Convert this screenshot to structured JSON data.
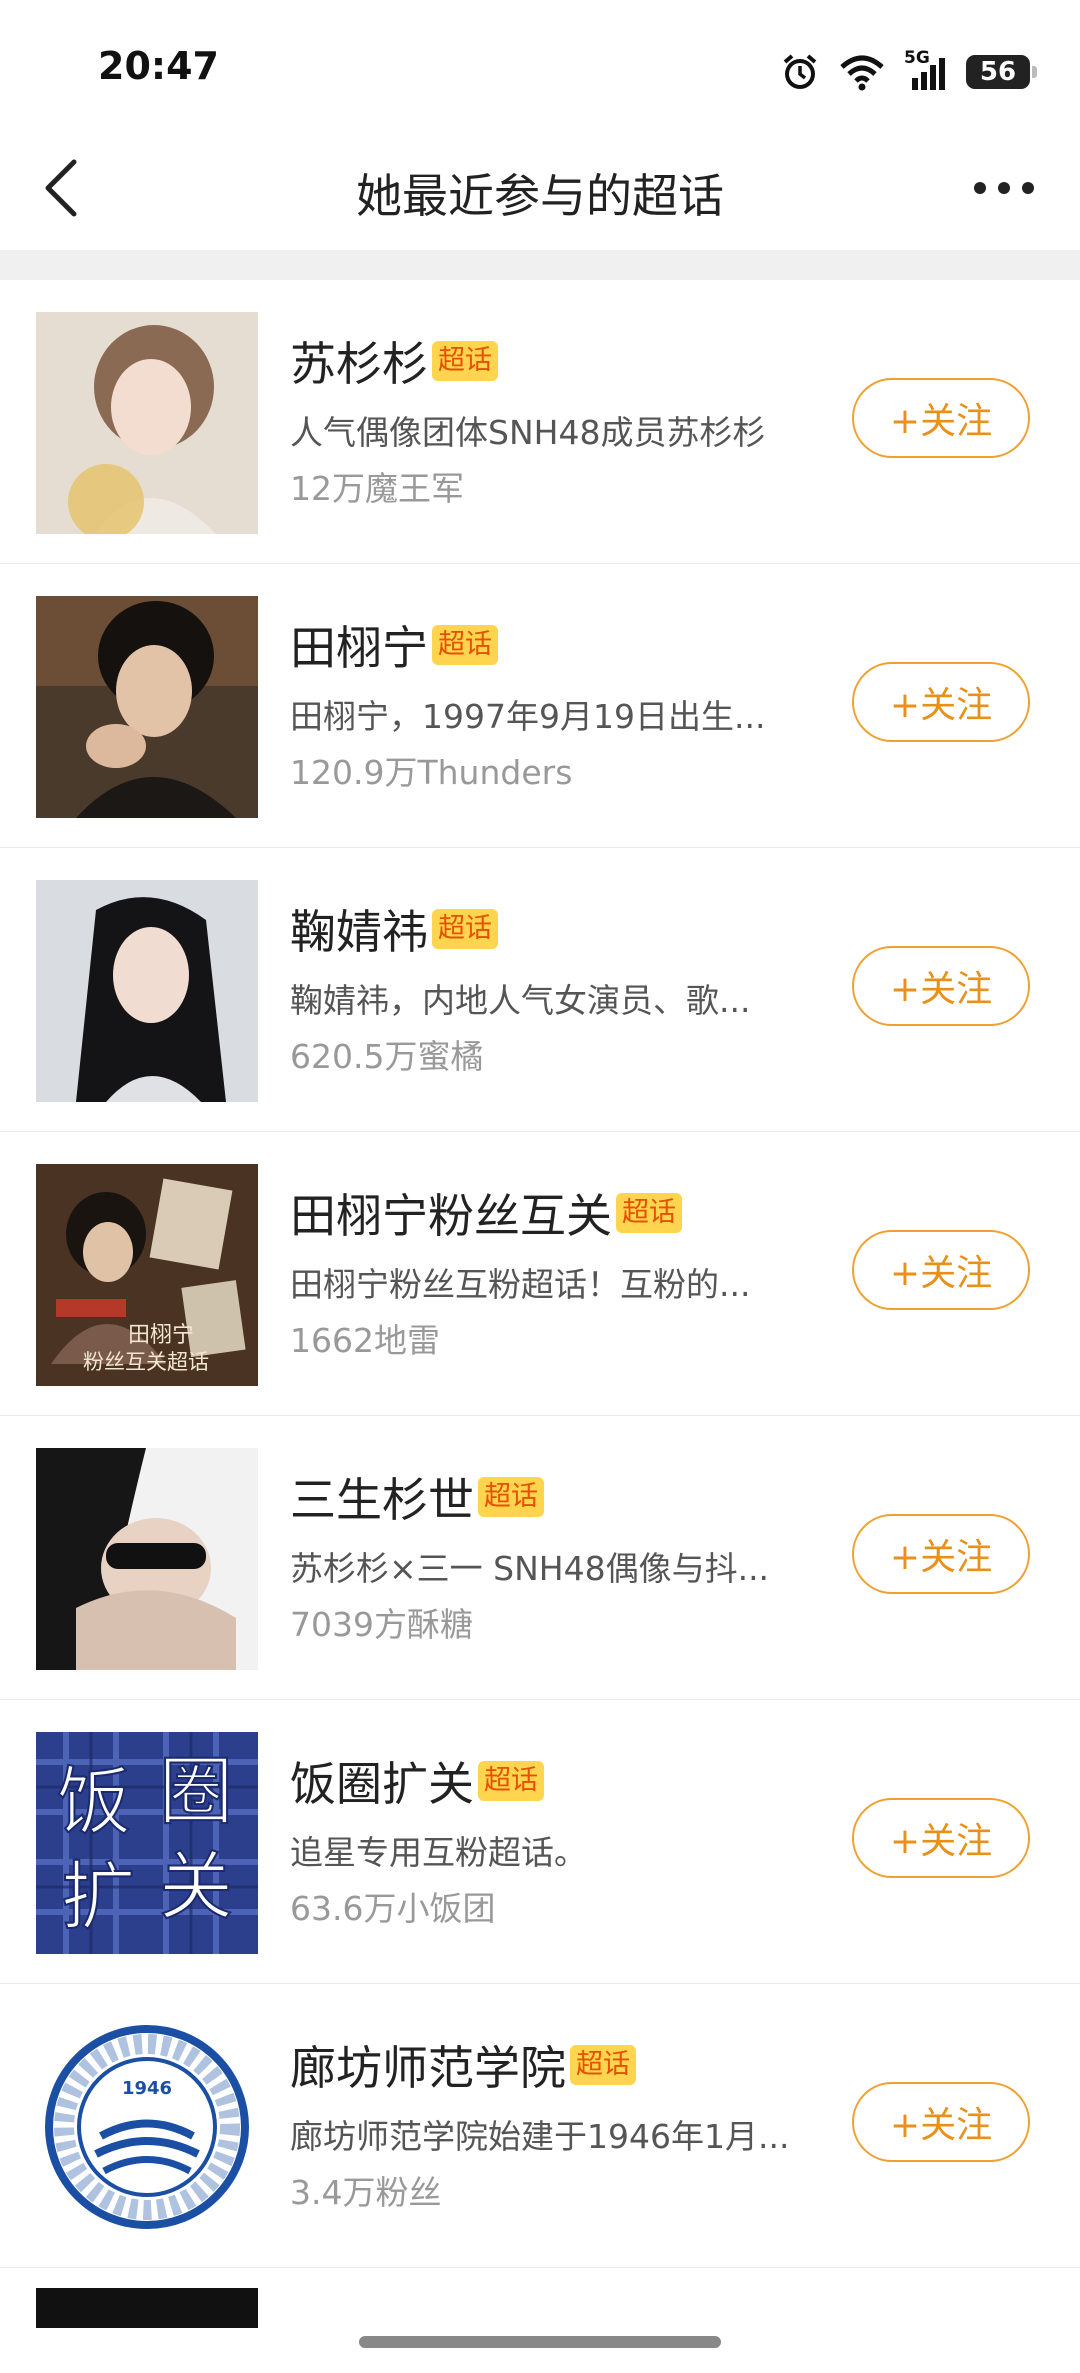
{
  "status_bar": {
    "time": "20:47",
    "network": "5G",
    "battery": "56"
  },
  "nav": {
    "title": "她最近参与的超话"
  },
  "items": [
    {
      "name": "苏杉杉",
      "badge": "超话",
      "desc": "人气偶像团体SNH48成员苏杉杉",
      "fans": "12万魔王军",
      "follow": "+关注"
    },
    {
      "name": "田栩宁",
      "badge": "超话",
      "desc": "田栩宁，1997年9月19日出生...",
      "fans": "120.9万Thunders",
      "follow": "+关注"
    },
    {
      "name": "鞠婧祎",
      "badge": "超话",
      "desc": "鞠婧祎，内地人气女演员、歌...",
      "fans": "620.5万蜜橘",
      "follow": "+关注"
    },
    {
      "name": "田栩宁粉丝互关",
      "badge": "超话",
      "desc": "田栩宁粉丝互粉超话！互粉的...",
      "fans": "1662地雷",
      "follow": "+关注",
      "thumb_text": [
        "田栩宁",
        "粉丝互关超话"
      ]
    },
    {
      "name": "三生杉世",
      "badge": "超话",
      "desc": "苏杉杉×三一 SNH48偶像与抖...",
      "fans": "7039方酥糖",
      "follow": "+关注"
    },
    {
      "name": "饭圈扩关",
      "badge": "超话",
      "desc": "追星专用互粉超话。",
      "fans": "63.6万小饭团",
      "follow": "+关注",
      "thumb_text": [
        "饭",
        "圈",
        "扩",
        "关"
      ]
    },
    {
      "name": "廊坊师范学院",
      "badge": "超话",
      "desc": "廊坊师范学院始建于1946年1月...",
      "fans": "3.4万粉丝",
      "follow": "+关注",
      "thumb_text": [
        "1946"
      ]
    }
  ],
  "colors": {
    "accent": "#e8901a",
    "badge_bg": "#ffd54f",
    "badge_text": "#e65100"
  }
}
